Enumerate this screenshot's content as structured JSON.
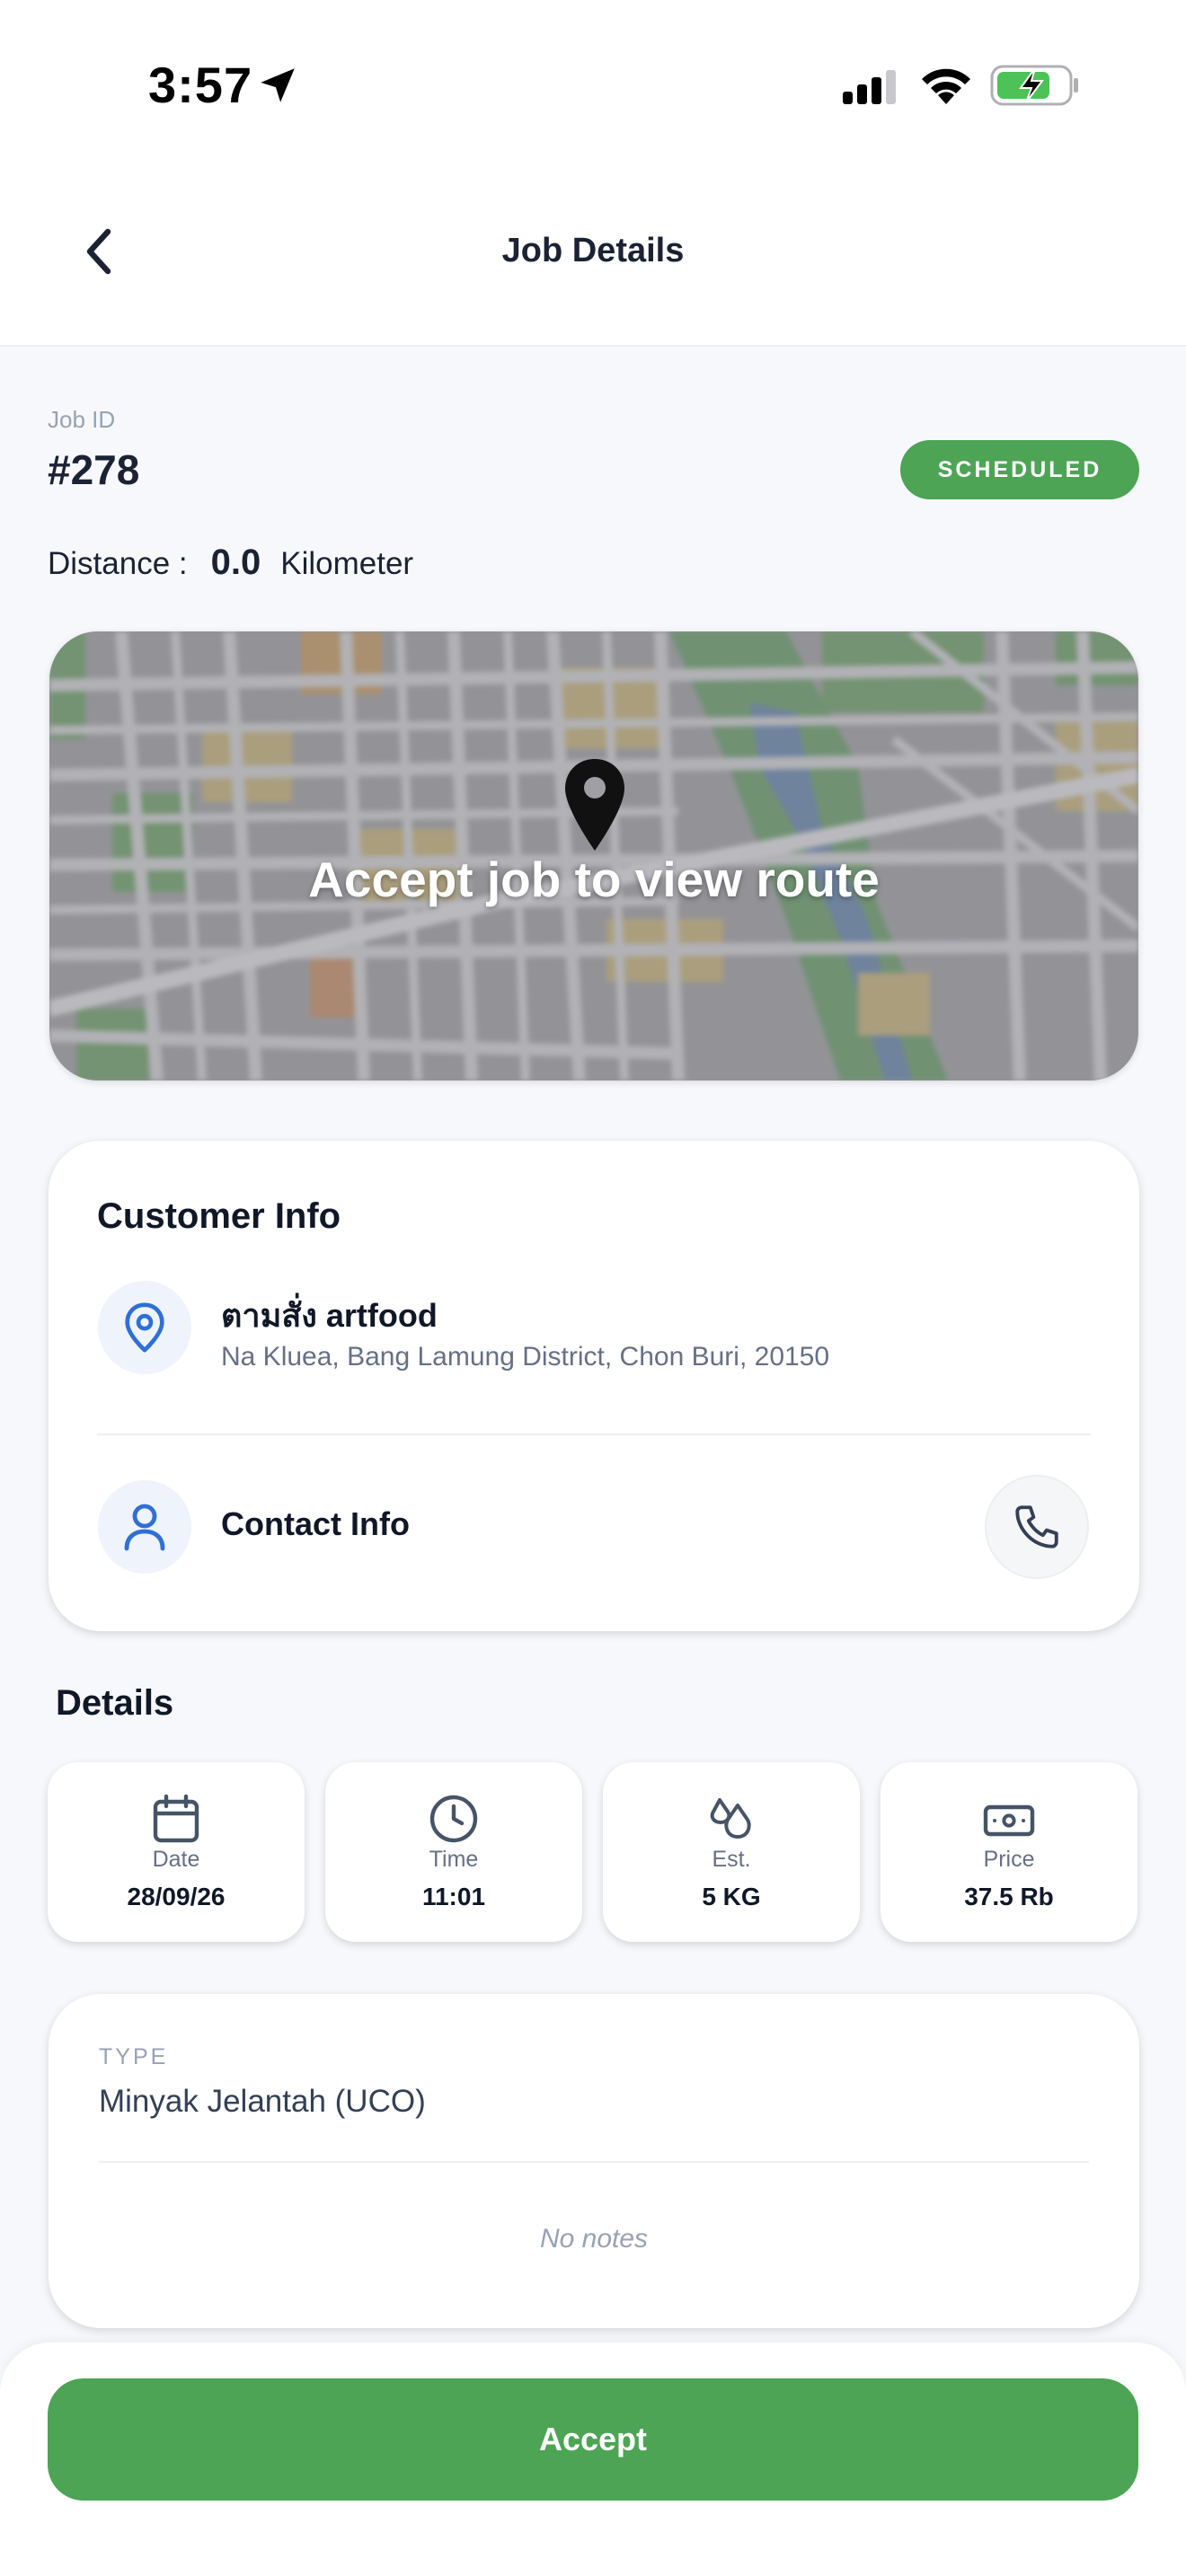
{
  "status_bar": {
    "time": "3:57"
  },
  "header": {
    "title": "Job Details"
  },
  "job": {
    "id_label": "Job ID",
    "id": "#278",
    "status": "SCHEDULED",
    "distance_label": "Distance :",
    "distance_value": "0.0",
    "distance_unit": "Kilometer"
  },
  "map": {
    "message": "Accept job to view route"
  },
  "customer": {
    "section_title": "Customer Info",
    "name": "ตามสั่ง artfood",
    "address": "Na Kluea, Bang Lamung District, Chon Buri, 20150",
    "contact_label": "Contact Info"
  },
  "details": {
    "section_title": "Details",
    "tiles": [
      {
        "label": "Date",
        "value": "28/09/26",
        "icon": "calendar-icon"
      },
      {
        "label": "Time",
        "value": "11:01",
        "icon": "clock-icon"
      },
      {
        "label": "Est.",
        "value": "5 KG",
        "icon": "droplets-icon"
      },
      {
        "label": "Price",
        "value": "37.5 Rb",
        "icon": "banknote-icon"
      }
    ]
  },
  "type_card": {
    "label": "TYPE",
    "value": "Minyak Jelantah (UCO)",
    "notes": "No notes"
  },
  "footer": {
    "accept_label": "Accept"
  },
  "colors": {
    "accent_green": "#4ca454",
    "icon_blue": "#2f6fd6",
    "background": "#f7f8fb"
  }
}
